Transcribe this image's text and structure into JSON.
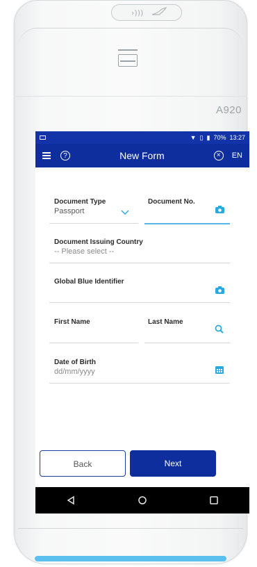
{
  "device": {
    "model": "A920"
  },
  "statusbar": {
    "battery": "70%",
    "time": "13:27"
  },
  "appbar": {
    "title": "New Form",
    "language": "EN",
    "help_symbol": "?",
    "close_symbol": "×"
  },
  "form": {
    "document_type": {
      "label": "Document Type",
      "value": "Passport"
    },
    "document_no": {
      "label": "Document No.",
      "value": ""
    },
    "issuing_country": {
      "label": "Document Issuing Country",
      "placeholder": "-- Please select --"
    },
    "global_blue_identifier": {
      "label": "Global Blue Identifier",
      "value": ""
    },
    "first_name": {
      "label": "First Name",
      "value": ""
    },
    "last_name": {
      "label": "Last Name",
      "value": ""
    },
    "date_of_birth": {
      "label": "Date of Birth",
      "placeholder": "dd/mm/yyyy"
    }
  },
  "buttons": {
    "back": "Back",
    "next": "Next"
  },
  "icons": {
    "camera": "camera-icon",
    "search": "search-icon",
    "calendar": "calendar-icon",
    "chevron": "chevron-down-icon",
    "nav_back": "nav-back-icon",
    "nav_home": "nav-home-icon",
    "nav_recent": "nav-recent-icon"
  },
  "colors": {
    "primary": "#0f2e9e",
    "accent": "#29a9e1",
    "bottom_strip": "#5cc0ef"
  }
}
